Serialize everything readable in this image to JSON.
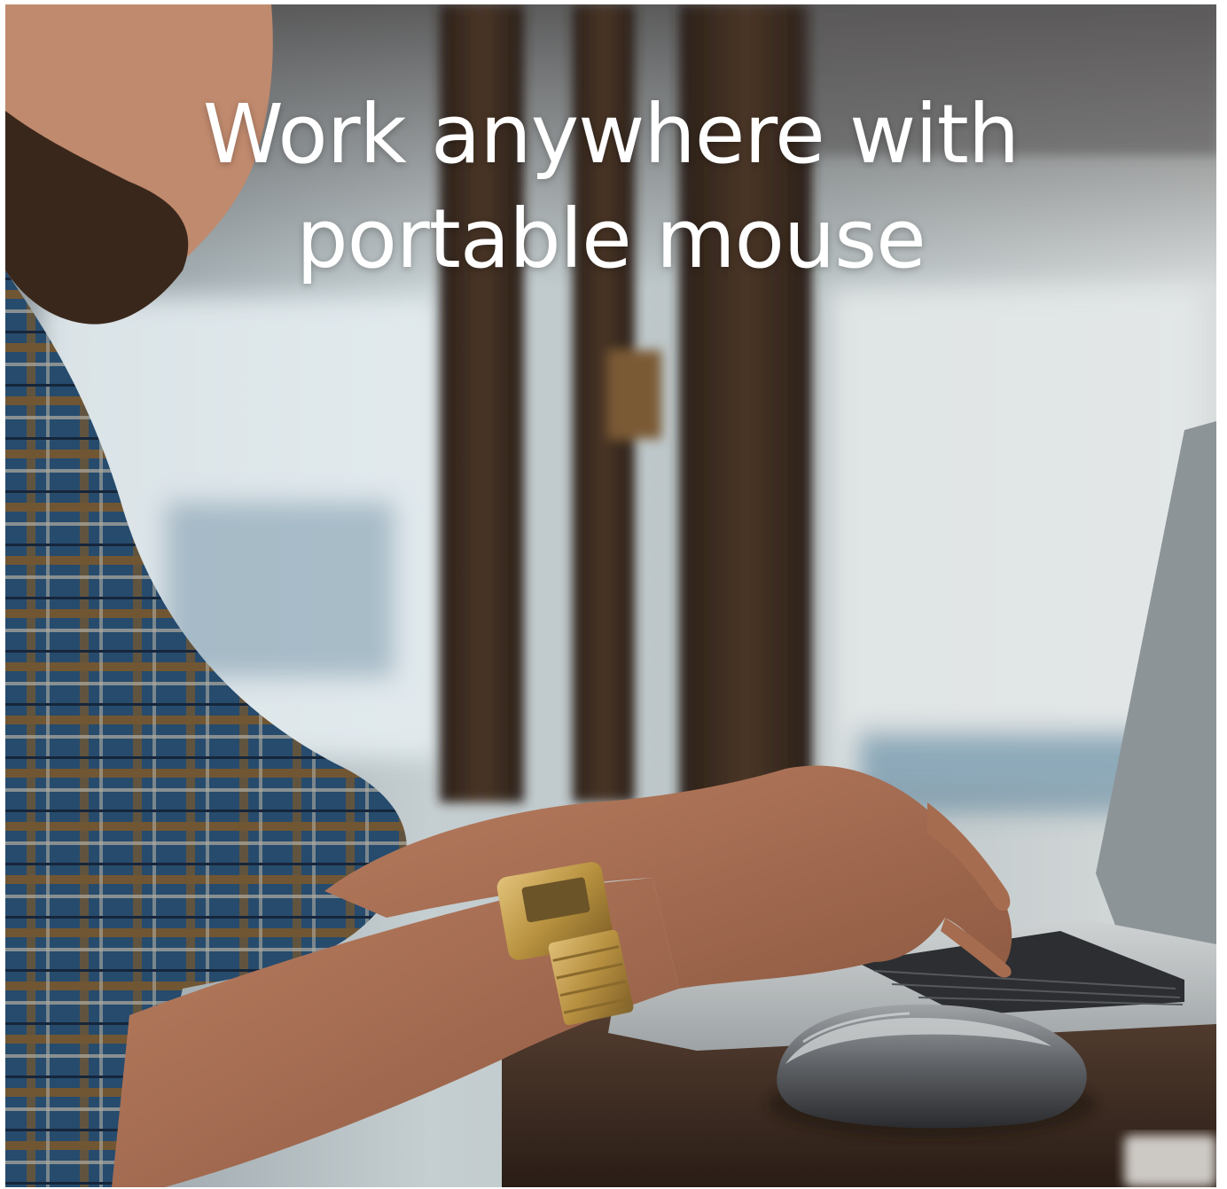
{
  "headline": {
    "line1": "Work anywhere with",
    "line2": "portable mouse"
  },
  "colors": {
    "headline_text": "#ffffff"
  }
}
